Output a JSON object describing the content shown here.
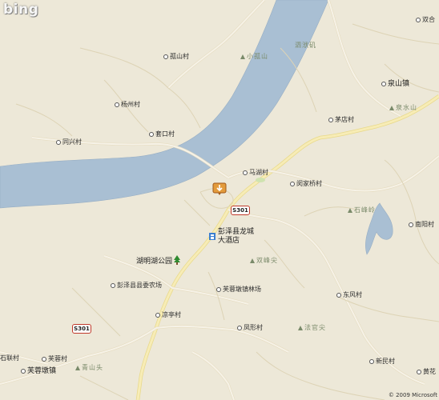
{
  "logo": "bing",
  "copyright": "© 2009 Microsoft",
  "colors": {
    "land": "#ede8d8",
    "water": "#a9bfd3",
    "road": "#f6f2e7",
    "road_edge": "#e2d9b8",
    "highway": "#f3e6a6"
  },
  "road_shields": [
    {
      "text": "S301"
    },
    {
      "text": "S301"
    }
  ],
  "places": [
    {
      "text": "双合",
      "type": "village"
    },
    {
      "text": "孤山村",
      "type": "village"
    },
    {
      "text": "小孤山",
      "type": "hill"
    },
    {
      "text": "泗洑矶",
      "type": "hill"
    },
    {
      "text": "杨州村",
      "type": "village"
    },
    {
      "text": "泉山镇",
      "type": "village"
    },
    {
      "text": "泉水山",
      "type": "hill"
    },
    {
      "text": "同兴村",
      "type": "village"
    },
    {
      "text": "套口村",
      "type": "village"
    },
    {
      "text": "茅店村",
      "type": "village"
    },
    {
      "text": "马湖村",
      "type": "village"
    },
    {
      "text": "闵家桥村",
      "type": "village"
    },
    {
      "text": "石峰岭",
      "type": "hill"
    },
    {
      "text": "南阳村",
      "type": "village"
    },
    {
      "text": "彭泽县龙城",
      "type": "poi"
    },
    {
      "text": "大酒店",
      "type": "poi"
    },
    {
      "text": "湖明湖公园",
      "type": "park"
    },
    {
      "text": "双峰尖",
      "type": "hill"
    },
    {
      "text": "彭泽县县委农场",
      "type": "village"
    },
    {
      "text": "芙蓉墩镇林场",
      "type": "village"
    },
    {
      "text": "东风村",
      "type": "village"
    },
    {
      "text": "凉亭村",
      "type": "village"
    },
    {
      "text": "凤形村",
      "type": "village"
    },
    {
      "text": "法官尖",
      "type": "hill"
    },
    {
      "text": "石联村",
      "type": "village"
    },
    {
      "text": "芙蓉村",
      "type": "village"
    },
    {
      "text": "芙蓉墩镇",
      "type": "village"
    },
    {
      "text": "青山头",
      "type": "hill"
    },
    {
      "text": "新民村",
      "type": "village"
    },
    {
      "text": "黄花",
      "type": "village"
    }
  ]
}
